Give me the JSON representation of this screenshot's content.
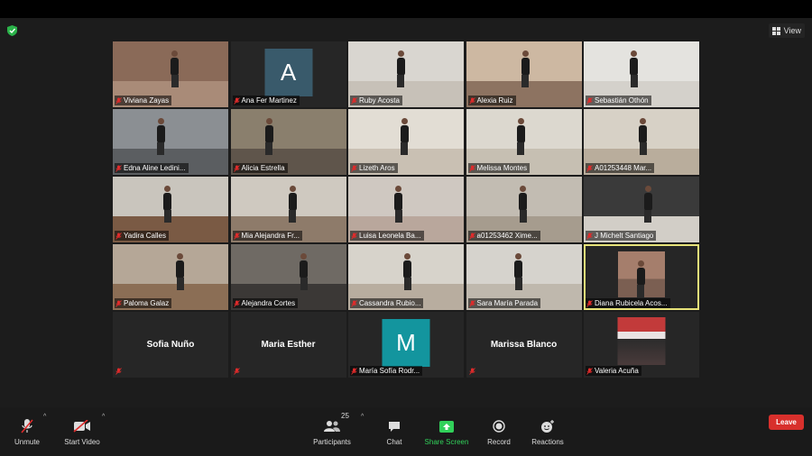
{
  "top": {
    "view_label": "View"
  },
  "participants": [
    {
      "name": "Viviana Zayas",
      "type": "video",
      "bg": "#8a6a58",
      "floor": "#a98b78"
    },
    {
      "name": "Ana Fer Martinez",
      "type": "avatar",
      "initial": "A",
      "avatar_color": "#395a6b"
    },
    {
      "name": "Ruby Acosta",
      "type": "video",
      "bg": "#d9d6d0",
      "floor": "#c7c1b8"
    },
    {
      "name": "Alexia Ruiz",
      "type": "video",
      "bg": "#cdb8a2",
      "floor": "#8d7361"
    },
    {
      "name": "Sebastián Othón",
      "type": "video",
      "bg": "#e4e3df",
      "floor": "#d4d1cb"
    },
    {
      "name": "Edna Aline Ledini...",
      "type": "video",
      "bg": "#8b8f93",
      "floor": "#5b5e61"
    },
    {
      "name": "Alicia Estrella",
      "type": "video",
      "bg": "#8a7f6d",
      "floor": "#5f554b"
    },
    {
      "name": "Lizeth Aros",
      "type": "video",
      "bg": "#e2ddd4",
      "floor": "#c9c0b3"
    },
    {
      "name": "Melissa Montes",
      "type": "video",
      "bg": "#dcd8cf",
      "floor": "#c6bfb2"
    },
    {
      "name": "A01253448 Mar...",
      "type": "video",
      "bg": "#d7d1c6",
      "floor": "#b9ad9c"
    },
    {
      "name": "Yadira Calles",
      "type": "video",
      "bg": "#c9c5bd",
      "floor": "#7a5a44"
    },
    {
      "name": "Mia Alejandra Fr...",
      "type": "video",
      "bg": "#cfc9c0",
      "floor": "#8e7b6a"
    },
    {
      "name": "Luisa Leonela Ba...",
      "type": "video",
      "bg": "#cfc8c1",
      "floor": "#b9a79c"
    },
    {
      "name": "a01253462 Xime...",
      "type": "video",
      "bg": "#c2bcb2",
      "floor": "#a69c8e"
    },
    {
      "name": "J Michelt Santiago",
      "type": "video",
      "bg": "#3a3a3a",
      "floor": "#d2cec7"
    },
    {
      "name": "Paloma Galaz",
      "type": "video",
      "bg": "#b5a797",
      "floor": "#8b6e55"
    },
    {
      "name": "Alejandra Cortes",
      "type": "video",
      "bg": "#6f6a64",
      "floor": "#3b3836"
    },
    {
      "name": "Cassandra Rubio...",
      "type": "video",
      "bg": "#d7d3cb",
      "floor": "#b8ad9f"
    },
    {
      "name": "Sara María Parada",
      "type": "video",
      "bg": "#d6d3cd",
      "floor": "#bfb8ad"
    },
    {
      "name": "Diana Rubicela Acos...",
      "type": "video-small",
      "bg": "#a57e6c",
      "floor": "#7b5f52",
      "active": true
    },
    {
      "name": "Sofia Nuño",
      "type": "name"
    },
    {
      "name": "Maria Esther",
      "type": "name"
    },
    {
      "name": "María Sofía Rodr...",
      "type": "avatar",
      "initial": "M",
      "avatar_color": "#13959e"
    },
    {
      "name": "Marissa Blanco",
      "type": "name"
    },
    {
      "name": "Valeria Acuña",
      "type": "photo"
    }
  ],
  "toolbar": {
    "unmute": "Unmute",
    "start_video": "Start Video",
    "participants_label": "Participants",
    "participants_count": "25",
    "chat": "Chat",
    "share_screen": "Share Screen",
    "record": "Record",
    "reactions": "Reactions",
    "leave": "Leave"
  },
  "colors": {
    "accent_green": "#31d15a",
    "leave_red": "#d8302c",
    "active_speaker": "#e7e37a",
    "muted_red": "#e02b2b"
  }
}
